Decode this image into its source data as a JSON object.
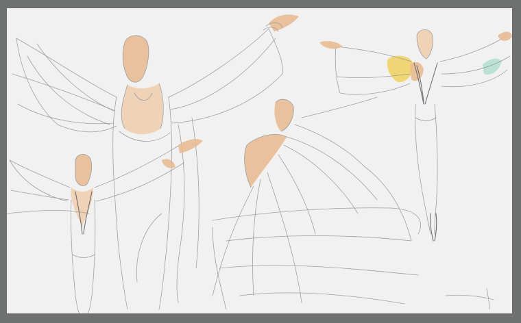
{
  "artwork": {
    "palette": {
      "background": "#6f7070",
      "paper": "#f1f1f2",
      "pencil": "#8e9196",
      "skin_wash": "#e9b98e",
      "yellow_wash": "#f1cf55",
      "teal_wash": "#a8dcc8"
    }
  }
}
